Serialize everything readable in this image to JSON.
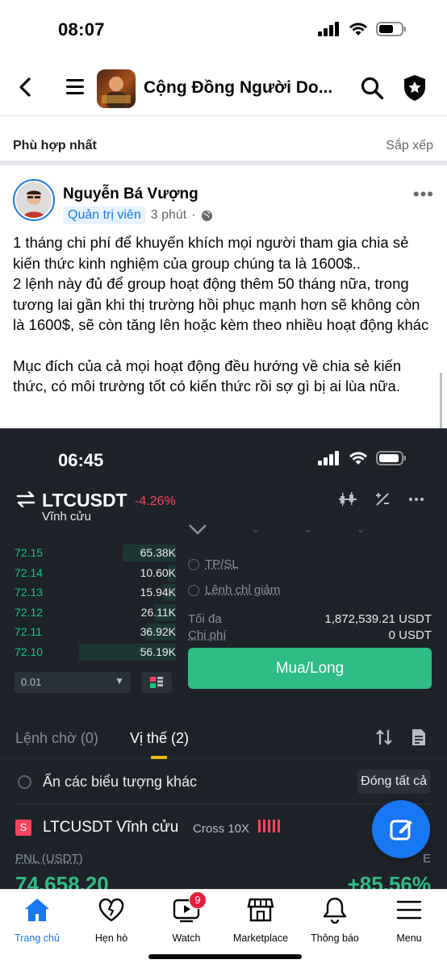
{
  "status_bar": {
    "time": "08:07"
  },
  "header": {
    "group_title": "Cộng Đồng Người Do..."
  },
  "sort": {
    "label": "Phù hợp nhất",
    "action": "Sắp xếp"
  },
  "post": {
    "author": "Nguyễn Bá Vượng",
    "role_badge": "Quản trị viên",
    "time": "3 phút",
    "more": "•••",
    "paragraphs": [
      "1 tháng chi phí để khuyến khích mọi người tham gia chia sẻ kiến thức kinh nghiệm của group chúng ta là 1600$..",
      "2 lệnh này đủ để group hoạt động thêm 50 tháng nữa, trong tương lai gần khi thị trường hồi phục mạnh hơn sẽ không còn là 1600$, sẽ còn tăng lên hoặc kèm theo nhiều hoạt động khác",
      "Mục đích của cả mọi hoạt động đều hướng về chia sẻ kiến thức, có môi trường tốt có kiến thức rồi sợ gì bị ai lùa nữa."
    ]
  },
  "embedded": {
    "time": "06:45",
    "pair": "LTCUSDT",
    "change": "-4.26%",
    "subtitle": "Vĩnh cửu",
    "orderbook": [
      {
        "price": "72.15",
        "qty": "65.38K",
        "depth": 0.33
      },
      {
        "price": "72.14",
        "qty": "10.60K",
        "depth": 0.05
      },
      {
        "price": "72.13",
        "qty": "15.94K",
        "depth": 0.08
      },
      {
        "price": "72.12",
        "qty": "26.11K",
        "depth": 0.13
      },
      {
        "price": "72.11",
        "qty": "36.92K",
        "depth": 0.19
      },
      {
        "price": "72.10",
        "qty": "56.19K",
        "depth": 0.6
      }
    ],
    "precision": "0.01",
    "tpsl_label": "TP/SL",
    "reduce_label": "Lệnh chỉ giảm",
    "max_label": "Tối đa",
    "max_value": "1,872,539.21 USDT",
    "cost_label": "Chi phí",
    "cost_value": "0 USDT",
    "buy_label": "Mua/Long",
    "tab_open": "Lệnh chờ (0)",
    "tab_positions": "Vị thế (2)",
    "hide_label": "Ẩn các biểu tượng khác",
    "close_all": "Đóng tất cả",
    "position_badge": "S",
    "position_name": "LTCUSDT Vĩnh cửu",
    "position_mode": "Cross 10X",
    "pnl_label": "PNL (USDT)",
    "pnl_value": "74,658.20",
    "roe_label": "E",
    "roe_value": "+85.56%"
  },
  "bottom_nav": {
    "home": "Trang chủ",
    "dating": "Hẹn hò",
    "watch": "Watch",
    "watch_badge": "9",
    "marketplace": "Marketplace",
    "notifications": "Thông báo",
    "menu": "Menu"
  },
  "colors": {
    "accent": "#1877f2",
    "buy_green": "#2ebd85",
    "sell_red": "#f6465d"
  }
}
